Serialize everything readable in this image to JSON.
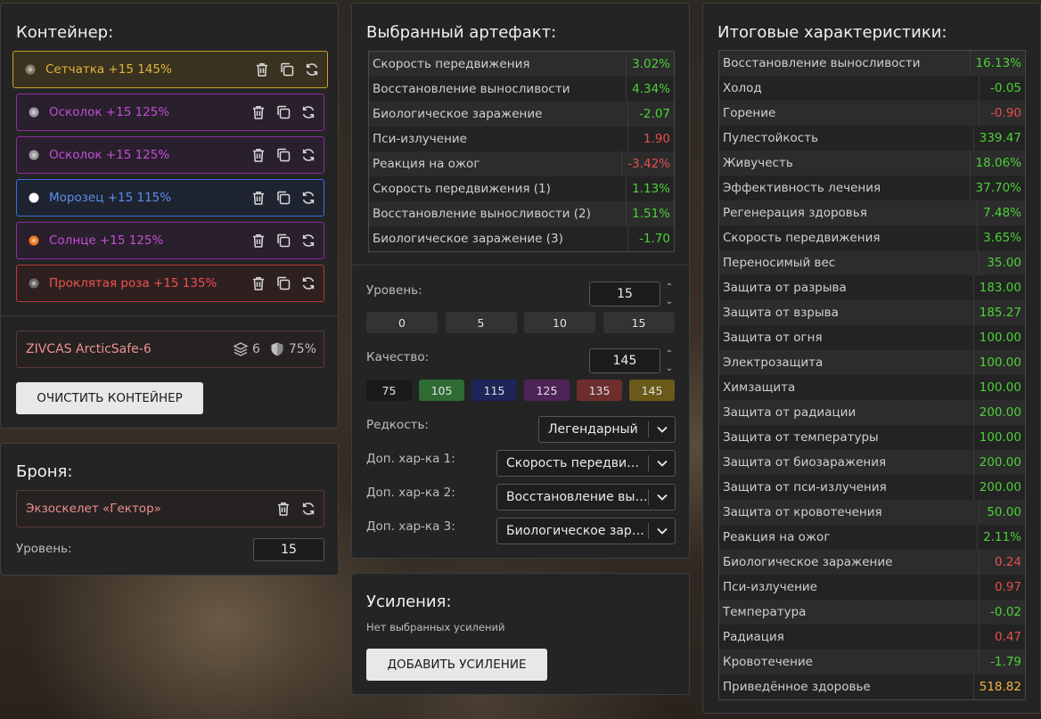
{
  "container": {
    "title": "Контейнер:",
    "artifacts": [
      {
        "name": "Сетчатка +15 145%",
        "color": "#e0b43c",
        "border": "#c9a227",
        "bg": "#3a3220",
        "glyph": "#8a7a6a"
      },
      {
        "name": "Осколок +15 125%",
        "color": "#c24fd6",
        "border": "#8c2ba0",
        "bg": "#2a1f2c",
        "glyph": "#9a9a9a"
      },
      {
        "name": "Осколок +15 125%",
        "color": "#c24fd6",
        "border": "#8c2ba0",
        "bg": "#2a1f2c",
        "glyph": "#9a9a9a"
      },
      {
        "name": "Морозец +15 115%",
        "color": "#5a8ef0",
        "border": "#3c6fd8",
        "bg": "#1e2330",
        "glyph": "#ffffff"
      },
      {
        "name": "Солнце +15 125%",
        "color": "#c24fd6",
        "border": "#8c2ba0",
        "bg": "#2a1f2c",
        "glyph": "#f07820"
      },
      {
        "name": "Проклятая роза +15 135%",
        "color": "#f05050",
        "border": "#b83a3a",
        "bg": "#2e2020",
        "glyph": "#6a6a6a"
      }
    ],
    "case": {
      "name": "ZIVCAS ArcticSafe-6",
      "slots": "6",
      "protection": "75%"
    },
    "clear_button": "ОЧИСТИТЬ КОНТЕЙНЕР"
  },
  "armor": {
    "title": "Броня:",
    "item": "Экзоскелет «Гектор»",
    "level_label": "Уровень:",
    "level_value": "15"
  },
  "selected": {
    "title": "Выбранный артефакт:",
    "stats": [
      {
        "name": "Скорость передвижения",
        "value": "3.02%",
        "tone": "pos"
      },
      {
        "name": "Восстановление выносливости",
        "value": "4.34%",
        "tone": "pos"
      },
      {
        "name": "Биологическое заражение",
        "value": "-2.07",
        "tone": "pos"
      },
      {
        "name": "Пси-излучение",
        "value": "1.90",
        "tone": "neg"
      },
      {
        "name": "Реакция на ожог",
        "value": "-3.42%",
        "tone": "neg"
      },
      {
        "name": "Скорость передвижения (1)",
        "value": "1.13%",
        "tone": "pos"
      },
      {
        "name": "Восстановление выносливости (2)",
        "value": "1.51%",
        "tone": "pos"
      },
      {
        "name": "Биологическое заражение (3)",
        "value": "-1.70",
        "tone": "pos"
      }
    ],
    "level_label": "Уровень:",
    "level_value": "15",
    "level_presets": [
      "0",
      "5",
      "10",
      "15"
    ],
    "quality_label": "Качество:",
    "quality_value": "145",
    "quality_presets": [
      {
        "label": "75",
        "bg": "#1a1a1a"
      },
      {
        "label": "105",
        "bg": "#2e6b34"
      },
      {
        "label": "115",
        "bg": "#1e2558"
      },
      {
        "label": "125",
        "bg": "#4e2458"
      },
      {
        "label": "135",
        "bg": "#6e2e2e"
      },
      {
        "label": "145",
        "bg": "#6a5a1a"
      }
    ],
    "rarity_label": "Редкость:",
    "rarity_value": "Легендарный",
    "extra1_label": "Доп. хар-ка 1:",
    "extra1_value": "Скорость передвижения",
    "extra2_label": "Доп. хар-ка 2:",
    "extra2_value": "Восстановление выносливости",
    "extra3_label": "Доп. хар-ка 3:",
    "extra3_value": "Биологическое заражение"
  },
  "boosts": {
    "title": "Усиления:",
    "empty_text": "Нет выбранных усилений",
    "add_button": "ДОБАВИТЬ УСИЛЕНИЕ"
  },
  "totals": {
    "title": "Итоговые характеристики:",
    "stats": [
      {
        "name": "Восстановление выносливости",
        "value": "16.13%",
        "tone": "pos"
      },
      {
        "name": "Холод",
        "value": "-0.05",
        "tone": "pos"
      },
      {
        "name": "Горение",
        "value": "-0.90",
        "tone": "neg"
      },
      {
        "name": "Пулестойкость",
        "value": "339.47",
        "tone": "pos"
      },
      {
        "name": "Живучесть",
        "value": "18.06%",
        "tone": "pos"
      },
      {
        "name": "Эффективность лечения",
        "value": "37.70%",
        "tone": "pos"
      },
      {
        "name": "Регенерация здоровья",
        "value": "7.48%",
        "tone": "pos"
      },
      {
        "name": "Скорость передвижения",
        "value": "3.65%",
        "tone": "pos"
      },
      {
        "name": "Переносимый вес",
        "value": "35.00",
        "tone": "pos"
      },
      {
        "name": "Защита от разрыва",
        "value": "183.00",
        "tone": "pos"
      },
      {
        "name": "Защита от взрыва",
        "value": "185.27",
        "tone": "pos"
      },
      {
        "name": "Защита от огня",
        "value": "100.00",
        "tone": "pos"
      },
      {
        "name": "Электрозащита",
        "value": "100.00",
        "tone": "pos"
      },
      {
        "name": "Химзащита",
        "value": "100.00",
        "tone": "pos"
      },
      {
        "name": "Защита от радиации",
        "value": "200.00",
        "tone": "pos"
      },
      {
        "name": "Защита от температуры",
        "value": "100.00",
        "tone": "pos"
      },
      {
        "name": "Защита от биозаражения",
        "value": "200.00",
        "tone": "pos"
      },
      {
        "name": "Защита от пси-излучения",
        "value": "200.00",
        "tone": "pos"
      },
      {
        "name": "Защита от кровотечения",
        "value": "50.00",
        "tone": "pos"
      },
      {
        "name": "Реакция на ожог",
        "value": "2.11%",
        "tone": "pos"
      },
      {
        "name": "Биологическое заражение",
        "value": "0.24",
        "tone": "neg"
      },
      {
        "name": "Пси-излучение",
        "value": "0.97",
        "tone": "neg"
      },
      {
        "name": "Температура",
        "value": "-0.02",
        "tone": "pos"
      },
      {
        "name": "Радиация",
        "value": "0.47",
        "tone": "neg"
      },
      {
        "name": "Кровотечение",
        "value": "-1.79",
        "tone": "pos"
      },
      {
        "name": "Приведённое здоровье",
        "value": "518.82",
        "tone": "gold"
      }
    ]
  }
}
